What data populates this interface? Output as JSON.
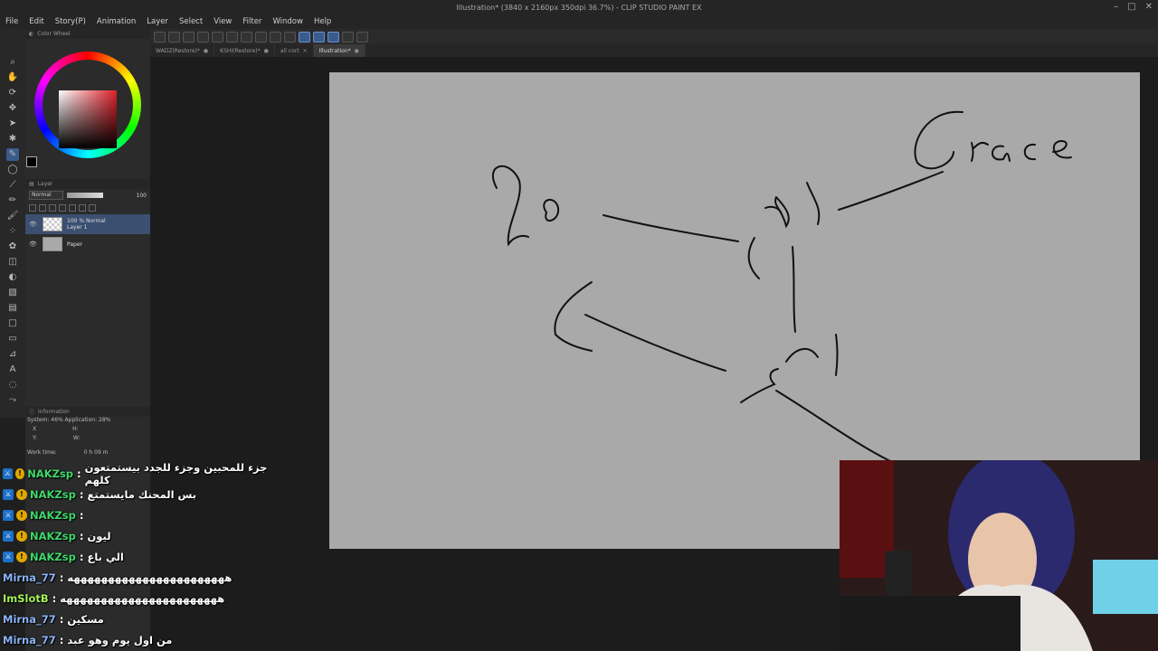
{
  "window": {
    "title": "Illustration* (3840 x 2160px 350dpi 36.7%) - CLIP STUDIO PAINT EX"
  },
  "menu": [
    "File",
    "Edit",
    "Story(P)",
    "Animation",
    "Layer",
    "Select",
    "View",
    "Filter",
    "Window",
    "Help"
  ],
  "tabs": [
    {
      "label": "WADZ(Restore)*",
      "active": false
    },
    {
      "label": "KSHI(Restore)*",
      "active": false
    },
    {
      "label": "all cort",
      "active": false
    },
    {
      "label": "Illustration*",
      "active": true
    }
  ],
  "color_wheel": {
    "title": "Color Wheel",
    "main_color": "#000000",
    "sub_color": "#ffffff"
  },
  "layer_panel": {
    "title": "Layer",
    "blend_mode": "Normal",
    "opacity": "100",
    "layers": [
      {
        "line1": "100 % Normal",
        "line2": "Layer 1",
        "active": true
      },
      {
        "line1": "",
        "line2": "Paper",
        "active": false
      }
    ]
  },
  "info_panel": {
    "title": "Information",
    "line": "System: 46% Application: 28%",
    "x_label": "X",
    "y_label": "Y:",
    "h_label": "H:",
    "w_label": "W:",
    "work_time_label": "Work time:",
    "work_time": "0 h 09 m"
  },
  "canvas": {
    "drawn_text": "Grace",
    "drawn_number": "20"
  },
  "chat": [
    {
      "user": "NAKZsp",
      "color": "green",
      "badges": true,
      "msg": "جزء للمحبين وجزء للجدد بيستمتعون كلهم"
    },
    {
      "user": "NAKZsp",
      "color": "green",
      "badges": true,
      "msg": "بس المحنك مايستمتع"
    },
    {
      "user": "NAKZsp",
      "color": "green",
      "badges": true,
      "msg": ""
    },
    {
      "user": "NAKZsp",
      "color": "green",
      "badges": true,
      "msg": "ليون"
    },
    {
      "user": "NAKZsp",
      "color": "green",
      "badges": true,
      "msg": "الي باع"
    },
    {
      "user": "Mirna_77",
      "color": "blue",
      "badges": false,
      "msg": "هههههههههههههههههههههههه"
    },
    {
      "user": "ImSlotB",
      "color": "lime",
      "badges": false,
      "msg": "هههههههههههههههههههههههه"
    },
    {
      "user": "Mirna_77",
      "color": "blue",
      "badges": false,
      "msg": "مسكين"
    },
    {
      "user": "Mirna_77",
      "color": "blue",
      "badges": false,
      "msg": "من اول يوم وهو عبد"
    }
  ],
  "colors": {
    "accent": "#3b5b8c",
    "canvas": "#a9a9a9",
    "chat_green": "#3fd86b",
    "chat_blue": "#8ab4f8"
  }
}
